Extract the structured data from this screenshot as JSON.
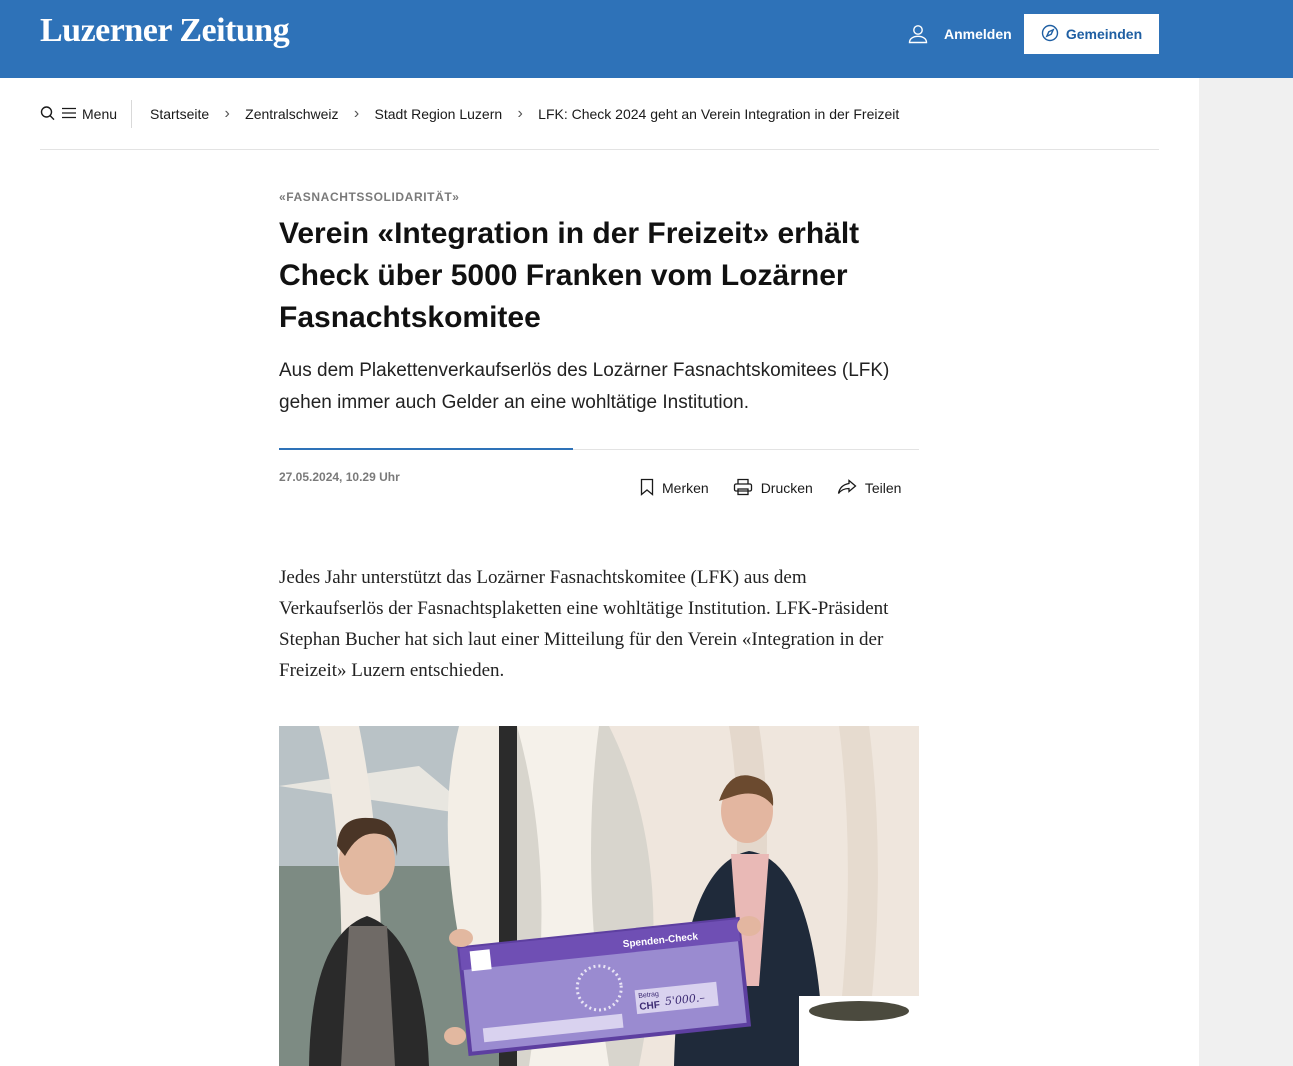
{
  "header": {
    "logo": "Luzerner Zeitung",
    "login_label": "Anmelden",
    "gemeinden_label": "Gemeinden",
    "background": "#2e72b8"
  },
  "nav": {
    "menu_label": "Menu",
    "breadcrumbs": [
      "Startseite",
      "Zentralschweiz",
      "Stadt Region Luzern",
      "LFK: Check 2024 geht an Verein Integration in der Freizeit"
    ]
  },
  "article": {
    "kicker": "«FASNACHTSSOLIDARITÄT»",
    "headline": "Verein «Integration in der Freizeit» erhält Check über 5000 Franken vom Lozärner Fasnachtskomitee",
    "lead": "Aus dem Plakettenverkaufserlös des Lozärner Fasnachtskomitees (LFK) gehen immer auch Gelder an eine wohltätige Institution.",
    "date": "27.05.2024, 10.29 Uhr",
    "actions": {
      "bookmark": "Merken",
      "print": "Drucken",
      "share": "Teilen"
    },
    "body": "Jedes Jahr unterstützt das Lozärner Fasnachtskomitee (LFK) aus dem Verkaufserlös der Fasnachtsplaketten eine wohltätige Institution. LFK-Präsident Stephan Bucher hat sich laut einer Mitteilung für den Verein «Integration in der Freizeit» Luzern entschieden.",
    "photo": {
      "check_title": "Spenden-Check",
      "amount_label": "Betrag",
      "currency": "CHF",
      "amount": "5'000.–"
    }
  },
  "icons": {
    "user": "user-icon",
    "compass": "compass-icon",
    "search": "search-icon",
    "bookmark": "bookmark-icon",
    "print": "printer-icon",
    "share": "share-icon"
  }
}
